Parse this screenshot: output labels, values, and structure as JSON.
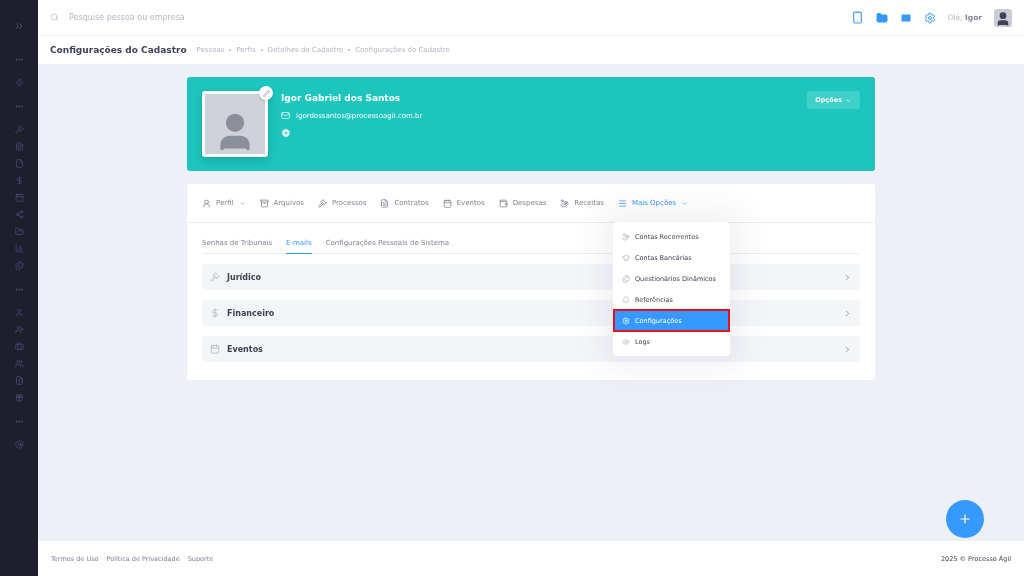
{
  "search": {
    "placeholder": "Pesquise pessoa ou empresa"
  },
  "user": {
    "greeting": "Olá,",
    "name": "Igor"
  },
  "subheader": {
    "title": "Configurações do Cadastro",
    "breadcrumbs": [
      "Pessoas",
      "Perfis",
      "Detalhes do Cadastro",
      "Configurações do Cadastro"
    ]
  },
  "profile": {
    "name": "Igor Gabriel dos Santos",
    "email": "igordossantos@processoagil.com.br",
    "options_button": "Opções"
  },
  "nav_tabs": [
    {
      "label": "Perfil",
      "selected": false,
      "dropdown": true
    },
    {
      "label": "Arquivos",
      "selected": false,
      "dropdown": false
    },
    {
      "label": "Processos",
      "selected": false,
      "dropdown": false
    },
    {
      "label": "Contratos",
      "selected": false,
      "dropdown": false
    },
    {
      "label": "Eventos",
      "selected": false,
      "dropdown": false
    },
    {
      "label": "Despesas",
      "selected": false,
      "dropdown": false
    },
    {
      "label": "Receitas",
      "selected": false,
      "dropdown": false
    },
    {
      "label": "Mais Opções",
      "selected": true,
      "dropdown": true
    }
  ],
  "sub_tabs": [
    {
      "label": "Senhas de Tribunais",
      "selected": false
    },
    {
      "label": "E-mails",
      "selected": true
    },
    {
      "label": "Configurações Pessoais de Sistema",
      "selected": false
    }
  ],
  "sections": [
    {
      "title": "Jurídico",
      "expanded": false
    },
    {
      "title": "Financeiro",
      "expanded": false
    },
    {
      "title": "Eventos",
      "expanded": false
    }
  ],
  "menu": [
    {
      "label": "Contas Recorrentes",
      "selected": false,
      "highlighted": false
    },
    {
      "label": "Contas Bancárias",
      "selected": false,
      "highlighted": false
    },
    {
      "label": "Questionários Dinâmicos",
      "selected": false,
      "highlighted": false
    },
    {
      "label": "Referências",
      "selected": false,
      "highlighted": false
    },
    {
      "label": "Configurações",
      "selected": true,
      "highlighted": true
    },
    {
      "label": "Logs",
      "selected": false,
      "highlighted": false
    }
  ],
  "footer": {
    "links": [
      "Termos de Uso",
      "Política de Privacidade",
      "Suporte"
    ],
    "copyright": "2025 © Processo Ágil"
  }
}
